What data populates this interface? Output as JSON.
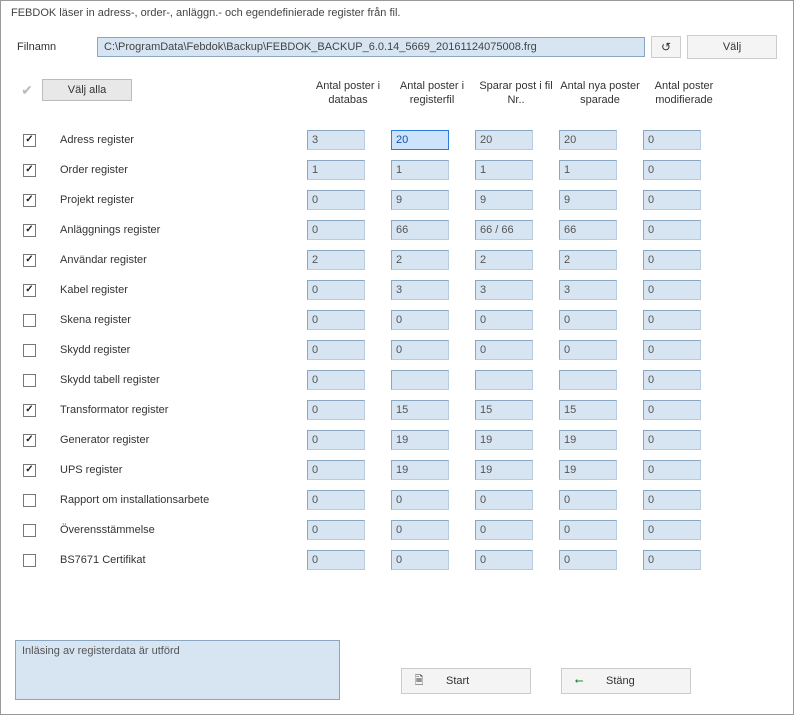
{
  "title": "FEBDOK läser in adress-, order-, anläggn.- och egendefinierade register från fil.",
  "file": {
    "label": "Filnamn",
    "path": "C:\\ProgramData\\Febdok\\Backup\\FEBDOK_BACKUP_6.0.14_5669_20161124075008.frg",
    "valj": "Välj"
  },
  "selectAll": {
    "label": "Välj alla"
  },
  "columns": {
    "c0": "Antal poster i databas",
    "c1": "Antal poster i registerfil",
    "c2": "Sparar post i fil Nr..",
    "c3": "Antal nya poster sparade",
    "c4": "Antal poster modifierade"
  },
  "rows": {
    "r0": {
      "label": "Adress register",
      "checked": true,
      "v0": "3",
      "v1": "20",
      "v2": "20",
      "v3": "20",
      "v4": "0"
    },
    "r1": {
      "label": "Order register",
      "checked": true,
      "v0": "1",
      "v1": "1",
      "v2": "1",
      "v3": "1",
      "v4": "0"
    },
    "r2": {
      "label": "Projekt register",
      "checked": true,
      "v0": "0",
      "v1": "9",
      "v2": "9",
      "v3": "9",
      "v4": "0"
    },
    "r3": {
      "label": "Anläggnings register",
      "checked": true,
      "v0": "0",
      "v1": "66",
      "v2": "66 / 66",
      "v3": "66",
      "v4": "0"
    },
    "r4": {
      "label": "Användar register",
      "checked": true,
      "v0": "2",
      "v1": "2",
      "v2": "2",
      "v3": "2",
      "v4": "0"
    },
    "r5": {
      "label": "Kabel register",
      "checked": true,
      "v0": "0",
      "v1": "3",
      "v2": "3",
      "v3": "3",
      "v4": "0"
    },
    "r6": {
      "label": "Skena register",
      "checked": false,
      "v0": "0",
      "v1": "0",
      "v2": "0",
      "v3": "0",
      "v4": "0"
    },
    "r7": {
      "label": "Skydd register",
      "checked": false,
      "v0": "0",
      "v1": "0",
      "v2": "0",
      "v3": "0",
      "v4": "0"
    },
    "r8": {
      "label": "Skydd tabell register",
      "checked": false,
      "v0": "0",
      "v1": "",
      "v2": "",
      "v3": "",
      "v4": "0"
    },
    "r9": {
      "label": "Transformator register",
      "checked": true,
      "v0": "0",
      "v1": "15",
      "v2": "15",
      "v3": "15",
      "v4": "0"
    },
    "r10": {
      "label": "Generator register",
      "checked": true,
      "v0": "0",
      "v1": "19",
      "v2": "19",
      "v3": "19",
      "v4": "0"
    },
    "r11": {
      "label": "UPS register",
      "checked": true,
      "v0": "0",
      "v1": "19",
      "v2": "19",
      "v3": "19",
      "v4": "0"
    },
    "r12": {
      "label": "Rapport om installationsarbete",
      "checked": false,
      "v0": "0",
      "v1": "0",
      "v2": "0",
      "v3": "0",
      "v4": "0"
    },
    "r13": {
      "label": "Överensstämmelse",
      "checked": false,
      "v0": "0",
      "v1": "0",
      "v2": "0",
      "v3": "0",
      "v4": "0"
    },
    "r14": {
      "label": "BS7671 Certifikat",
      "checked": false,
      "v0": "0",
      "v1": "0",
      "v2": "0",
      "v3": "0",
      "v4": "0"
    }
  },
  "status": "Inläsing av registerdata är utförd",
  "buttons": {
    "start": "Start",
    "stang": "Stäng"
  }
}
